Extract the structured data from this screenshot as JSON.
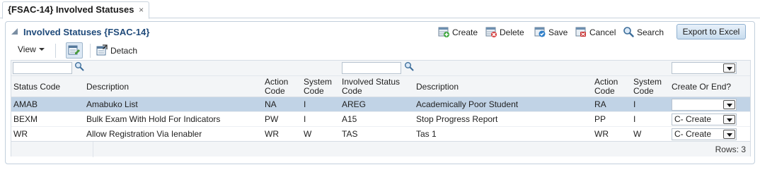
{
  "tab": {
    "title": "{FSAC-14} Involved Statuses",
    "close": "×"
  },
  "panel": {
    "title": "Involved Statuses {FSAC-14}"
  },
  "toolbar": {
    "create": "Create",
    "delete": "Delete",
    "save": "Save",
    "cancel": "Cancel",
    "search": "Search",
    "export": "Export to Excel",
    "view": "View",
    "detach": "Detach"
  },
  "table": {
    "columns": [
      "Status Code",
      "Description",
      "Action Code",
      "System Code",
      "Involved Status Code",
      "Description",
      "Action Code",
      "System Code",
      "Create Or End?"
    ],
    "rows": [
      {
        "status_code": "AMAB",
        "description": "Amabuko List",
        "action_code": "NA",
        "system_code": "I",
        "involved_status_code": "AREG",
        "involved_description": "Academically Poor Student",
        "involved_action_code": "RA",
        "involved_system_code": "I",
        "create_or_end": ""
      },
      {
        "status_code": "BEXM",
        "description": "Bulk Exam With Hold For Indicators",
        "action_code": "PW",
        "system_code": "I",
        "involved_status_code": "A15",
        "involved_description": "Stop Progress Report",
        "involved_action_code": "PP",
        "involved_system_code": "I",
        "create_or_end": "C- Create"
      },
      {
        "status_code": "WR",
        "description": "Allow Registration Via Ienabler",
        "action_code": "WR",
        "system_code": "W",
        "involved_status_code": "TAS",
        "involved_description": "Tas 1",
        "involved_action_code": "WR",
        "involved_system_code": "W",
        "create_or_end": "C- Create"
      }
    ],
    "footer": "Rows: 3"
  },
  "colors": {
    "title": "#1f4a7a",
    "selected_row": "#c1d3e6",
    "export_button": "#c8dcee"
  }
}
